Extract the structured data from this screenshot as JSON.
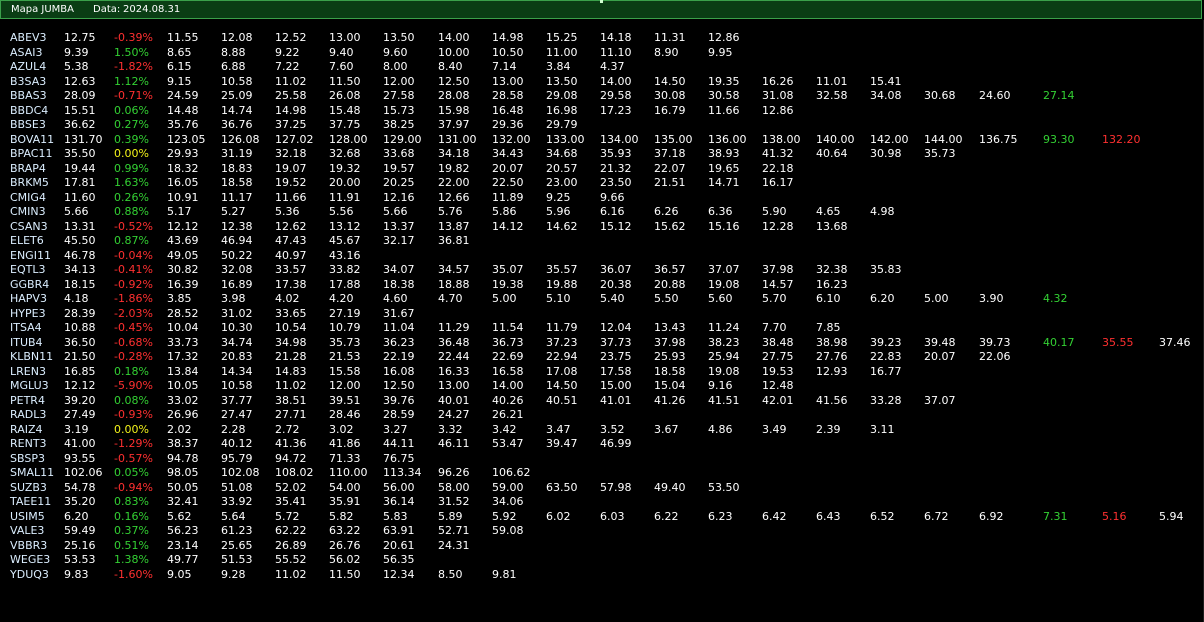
{
  "window": {
    "title": "Mapa JUMBA",
    "date_label": "Data:",
    "date_value": "2024.08.31"
  },
  "colors": {
    "background": "#000000",
    "titlebar": "#0a3d14",
    "positive": "#33d033",
    "negative": "#ff3030",
    "neutral": "#f2f21a",
    "text": "#ffffff"
  },
  "rows": [
    {
      "symbol": "ABEV3",
      "price": "12.75",
      "change": "-0.39%",
      "levels": [
        "11.55",
        "12.08",
        "12.52",
        "13.00",
        "13.50",
        "14.00",
        "14.98",
        "15.25",
        "14.18",
        "11.31",
        "12.86"
      ],
      "tail": []
    },
    {
      "symbol": "ASAI3",
      "price": "9.39",
      "change": "1.50%",
      "levels": [
        "8.65",
        "8.88",
        "9.22",
        "9.40",
        "9.60",
        "10.00",
        "10.50",
        "11.00",
        "11.10",
        "8.90",
        "9.95"
      ],
      "tail": []
    },
    {
      "symbol": "AZUL4",
      "price": "5.38",
      "change": "-1.82%",
      "levels": [
        "6.15",
        "6.88",
        "7.22",
        "7.60",
        "8.00",
        "8.40",
        "7.14",
        "3.84",
        "4.37"
      ],
      "tail": []
    },
    {
      "symbol": "B3SA3",
      "price": "12.63",
      "change": "1.12%",
      "levels": [
        "9.15",
        "10.58",
        "11.02",
        "11.50",
        "12.00",
        "12.50",
        "13.00",
        "13.50",
        "14.00",
        "14.50",
        "19.35",
        "16.26",
        "11.01",
        "15.41"
      ],
      "tail": []
    },
    {
      "symbol": "BBAS3",
      "price": "28.09",
      "change": "-0.71%",
      "levels": [
        "24.59",
        "25.09",
        "25.58",
        "26.08",
        "27.58",
        "28.08",
        "28.58",
        "29.08",
        "29.58",
        "30.08",
        "30.58",
        "31.08",
        "32.58",
        "34.08",
        "30.68",
        "24.60"
      ],
      "tail": [
        "27.14"
      ]
    },
    {
      "symbol": "BBDC4",
      "price": "15.51",
      "change": "0.06%",
      "levels": [
        "14.48",
        "14.74",
        "14.98",
        "15.48",
        "15.73",
        "15.98",
        "16.48",
        "16.98",
        "17.23",
        "16.79",
        "11.66",
        "12.86"
      ],
      "tail": []
    },
    {
      "symbol": "BBSE3",
      "price": "36.62",
      "change": "0.27%",
      "levels": [
        "35.76",
        "36.76",
        "37.25",
        "37.75",
        "38.25",
        "37.97",
        "29.36",
        "29.79"
      ],
      "tail": []
    },
    {
      "symbol": "BOVA11",
      "price": "131.70",
      "change": "0.39%",
      "levels": [
        "123.05",
        "126.08",
        "127.02",
        "128.00",
        "129.00",
        "131.00",
        "132.00",
        "133.00",
        "134.00",
        "135.00",
        "136.00",
        "138.00",
        "140.00",
        "142.00",
        "144.00",
        "136.75"
      ],
      "tail": [
        "93.30",
        "132.20"
      ]
    },
    {
      "symbol": "BPAC11",
      "price": "35.50",
      "change": "0.00%",
      "levels": [
        "29.93",
        "31.19",
        "32.18",
        "32.68",
        "33.68",
        "34.18",
        "34.43",
        "34.68",
        "35.93",
        "37.18",
        "38.93",
        "41.32",
        "40.64",
        "30.98",
        "35.73"
      ],
      "tail": []
    },
    {
      "symbol": "BRAP4",
      "price": "19.44",
      "change": "0.99%",
      "levels": [
        "18.32",
        "18.83",
        "19.07",
        "19.32",
        "19.57",
        "19.82",
        "20.07",
        "20.57",
        "21.32",
        "22.07",
        "19.65",
        "22.18"
      ],
      "tail": []
    },
    {
      "symbol": "BRKM5",
      "price": "17.81",
      "change": "1.63%",
      "levels": [
        "16.05",
        "18.58",
        "19.52",
        "20.00",
        "20.25",
        "22.00",
        "22.50",
        "23.00",
        "23.50",
        "21.51",
        "14.71",
        "16.17"
      ],
      "tail": []
    },
    {
      "symbol": "CMIG4",
      "price": "11.60",
      "change": "0.26%",
      "levels": [
        "10.91",
        "11.17",
        "11.66",
        "11.91",
        "12.16",
        "12.66",
        "11.89",
        "9.25",
        "9.66"
      ],
      "tail": []
    },
    {
      "symbol": "CMIN3",
      "price": "5.66",
      "change": "0.88%",
      "levels": [
        "5.17",
        "5.27",
        "5.36",
        "5.56",
        "5.66",
        "5.76",
        "5.86",
        "5.96",
        "6.16",
        "6.26",
        "6.36",
        "5.90",
        "4.65",
        "4.98"
      ],
      "tail": []
    },
    {
      "symbol": "CSAN3",
      "price": "13.31",
      "change": "-0.52%",
      "levels": [
        "12.12",
        "12.38",
        "12.62",
        "13.12",
        "13.37",
        "13.87",
        "14.12",
        "14.62",
        "15.12",
        "15.62",
        "15.16",
        "12.28",
        "13.68"
      ],
      "tail": []
    },
    {
      "symbol": "ELET6",
      "price": "45.50",
      "change": "0.87%",
      "levels": [
        "43.69",
        "46.94",
        "47.43",
        "45.67",
        "32.17",
        "36.81"
      ],
      "tail": []
    },
    {
      "symbol": "ENGI11",
      "price": "46.78",
      "change": "-0.04%",
      "levels": [
        "49.05",
        "50.22",
        "40.97",
        "43.16"
      ],
      "tail": []
    },
    {
      "symbol": "EQTL3",
      "price": "34.13",
      "change": "-0.41%",
      "levels": [
        "30.82",
        "32.08",
        "33.57",
        "33.82",
        "34.07",
        "34.57",
        "35.07",
        "35.57",
        "36.07",
        "36.57",
        "37.07",
        "37.98",
        "32.38",
        "35.83"
      ],
      "tail": []
    },
    {
      "symbol": "GGBR4",
      "price": "18.15",
      "change": "-0.92%",
      "levels": [
        "16.39",
        "16.89",
        "17.38",
        "17.88",
        "18.38",
        "18.88",
        "19.38",
        "19.88",
        "20.38",
        "20.88",
        "19.08",
        "14.57",
        "16.23"
      ],
      "tail": []
    },
    {
      "symbol": "HAPV3",
      "price": "4.18",
      "change": "-1.86%",
      "levels": [
        "3.85",
        "3.98",
        "4.02",
        "4.20",
        "4.60",
        "4.70",
        "5.00",
        "5.10",
        "5.40",
        "5.50",
        "5.60",
        "5.70",
        "6.10",
        "6.20",
        "5.00",
        "3.90"
      ],
      "tail": [
        "4.32"
      ]
    },
    {
      "symbol": "HYPE3",
      "price": "28.39",
      "change": "-2.03%",
      "levels": [
        "28.52",
        "31.02",
        "33.65",
        "27.19",
        "31.67"
      ],
      "tail": []
    },
    {
      "symbol": "ITSA4",
      "price": "10.88",
      "change": "-0.45%",
      "levels": [
        "10.04",
        "10.30",
        "10.54",
        "10.79",
        "11.04",
        "11.29",
        "11.54",
        "11.79",
        "12.04",
        "13.43",
        "11.24",
        "7.70",
        "7.85"
      ],
      "tail": []
    },
    {
      "symbol": "ITUB4",
      "price": "36.50",
      "change": "-0.68%",
      "levels": [
        "33.73",
        "34.74",
        "34.98",
        "35.73",
        "36.23",
        "36.48",
        "36.73",
        "37.23",
        "37.73",
        "37.98",
        "38.23",
        "38.48",
        "38.98",
        "39.23",
        "39.48",
        "39.73"
      ],
      "tail": [
        "40.17",
        "35.55",
        "37.46"
      ]
    },
    {
      "symbol": "KLBN11",
      "price": "21.50",
      "change": "-0.28%",
      "levels": [
        "17.32",
        "20.83",
        "21.28",
        "21.53",
        "22.19",
        "22.44",
        "22.69",
        "22.94",
        "23.75",
        "25.93",
        "25.94",
        "27.75",
        "27.76",
        "22.83",
        "20.07",
        "22.06"
      ],
      "tail": []
    },
    {
      "symbol": "LREN3",
      "price": "16.85",
      "change": "0.18%",
      "levels": [
        "13.84",
        "14.34",
        "14.83",
        "15.58",
        "16.08",
        "16.33",
        "16.58",
        "17.08",
        "17.58",
        "18.58",
        "19.08",
        "19.53",
        "12.93",
        "16.77"
      ],
      "tail": []
    },
    {
      "symbol": "MGLU3",
      "price": "12.12",
      "change": "-5.90%",
      "levels": [
        "10.05",
        "10.58",
        "11.02",
        "12.00",
        "12.50",
        "13.00",
        "14.00",
        "14.50",
        "15.00",
        "15.04",
        "9.16",
        "12.48"
      ],
      "tail": []
    },
    {
      "symbol": "PETR4",
      "price": "39.20",
      "change": "0.08%",
      "levels": [
        "33.02",
        "37.77",
        "38.51",
        "39.51",
        "39.76",
        "40.01",
        "40.26",
        "40.51",
        "41.01",
        "41.26",
        "41.51",
        "42.01",
        "41.56",
        "33.28",
        "37.07"
      ],
      "tail": []
    },
    {
      "symbol": "RADL3",
      "price": "27.49",
      "change": "-0.93%",
      "levels": [
        "26.96",
        "27.47",
        "27.71",
        "28.46",
        "28.59",
        "24.27",
        "26.21"
      ],
      "tail": []
    },
    {
      "symbol": "RAIZ4",
      "price": "3.19",
      "change": "0.00%",
      "levels": [
        "2.02",
        "2.28",
        "2.72",
        "3.02",
        "3.27",
        "3.32",
        "3.42",
        "3.47",
        "3.52",
        "3.67",
        "4.86",
        "3.49",
        "2.39",
        "3.11"
      ],
      "tail": []
    },
    {
      "symbol": "RENT3",
      "price": "41.00",
      "change": "-1.29%",
      "levels": [
        "38.37",
        "40.12",
        "41.36",
        "41.86",
        "44.11",
        "46.11",
        "53.47",
        "39.47",
        "46.99"
      ],
      "tail": []
    },
    {
      "symbol": "SBSP3",
      "price": "93.55",
      "change": "-0.57%",
      "levels": [
        "94.78",
        "95.79",
        "94.72",
        "71.33",
        "76.75"
      ],
      "tail": []
    },
    {
      "symbol": "SMAL11",
      "price": "102.06",
      "change": "0.05%",
      "levels": [
        "98.05",
        "102.08",
        "108.02",
        "110.00",
        "113.34",
        "96.26",
        "106.62"
      ],
      "tail": []
    },
    {
      "symbol": "SUZB3",
      "price": "54.78",
      "change": "-0.94%",
      "levels": [
        "50.05",
        "51.08",
        "52.02",
        "54.00",
        "56.00",
        "58.00",
        "59.00",
        "63.50",
        "57.98",
        "49.40",
        "53.50"
      ],
      "tail": []
    },
    {
      "symbol": "TAEE11",
      "price": "35.20",
      "change": "0.83%",
      "levels": [
        "32.41",
        "33.92",
        "35.41",
        "35.91",
        "36.14",
        "31.52",
        "34.06"
      ],
      "tail": []
    },
    {
      "symbol": "USIM5",
      "price": "6.20",
      "change": "0.16%",
      "levels": [
        "5.62",
        "5.64",
        "5.72",
        "5.82",
        "5.83",
        "5.89",
        "5.92",
        "6.02",
        "6.03",
        "6.22",
        "6.23",
        "6.42",
        "6.43",
        "6.52",
        "6.72",
        "6.92"
      ],
      "tail": [
        "7.31",
        "5.16",
        "5.94"
      ]
    },
    {
      "symbol": "VALE3",
      "price": "59.49",
      "change": "0.37%",
      "levels": [
        "56.23",
        "61.23",
        "62.22",
        "63.22",
        "63.91",
        "52.71",
        "59.08"
      ],
      "tail": []
    },
    {
      "symbol": "VBBR3",
      "price": "25.16",
      "change": "0.51%",
      "levels": [
        "23.14",
        "25.65",
        "26.89",
        "26.76",
        "20.61",
        "24.31"
      ],
      "tail": []
    },
    {
      "symbol": "WEGE3",
      "price": "53.53",
      "change": "1.38%",
      "levels": [
        "49.77",
        "51.53",
        "55.52",
        "56.02",
        "56.35"
      ],
      "tail": []
    },
    {
      "symbol": "YDUQ3",
      "price": "9.83",
      "change": "-1.60%",
      "levels": [
        "9.05",
        "9.28",
        "11.02",
        "11.50",
        "12.34",
        "8.50",
        "9.81"
      ],
      "tail": []
    }
  ]
}
